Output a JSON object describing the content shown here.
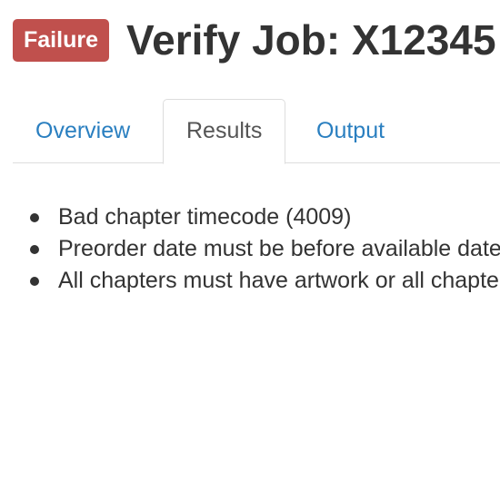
{
  "header": {
    "status_badge": "Failure",
    "title": "Verify Job: X12345"
  },
  "tabs": [
    {
      "label": "Overview",
      "active": false
    },
    {
      "label": "Results",
      "active": true
    },
    {
      "label": "Output",
      "active": false
    }
  ],
  "results": {
    "items": [
      "Bad chapter timecode (4009)",
      "Preorder date must be before available date",
      "All chapters must have artwork or all chapters"
    ]
  },
  "colors": {
    "failure_badge": "#c0504d",
    "link": "#2a7fc0",
    "text": "#333333",
    "border": "#dddddd"
  }
}
